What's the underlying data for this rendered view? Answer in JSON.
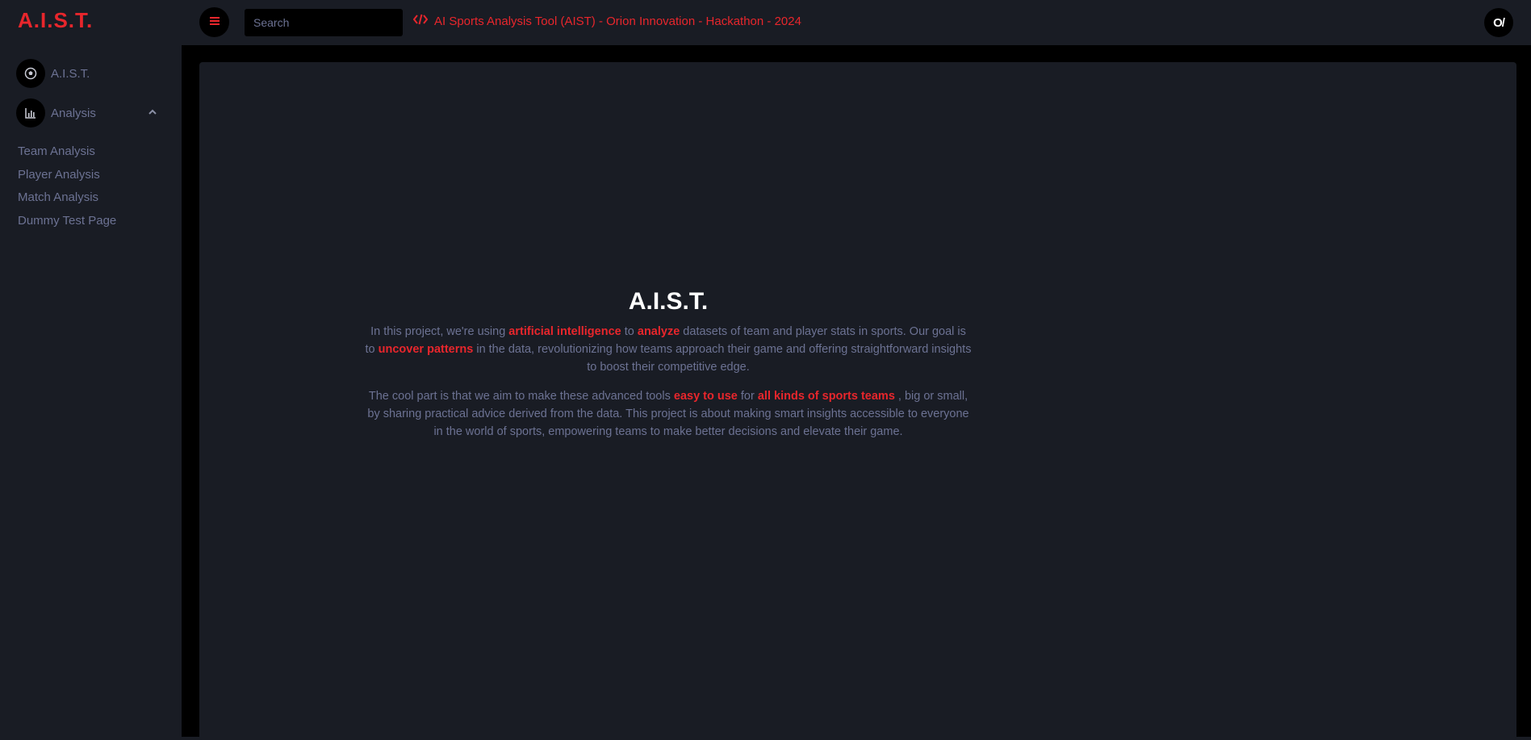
{
  "sidebar": {
    "brand": "A.I.S.T.",
    "items": [
      {
        "label": "A.I.S.T.",
        "icon": "soccer-ball-icon"
      },
      {
        "label": "Analysis",
        "icon": "bar-chart-icon"
      }
    ],
    "submenu": [
      "Team Analysis",
      "Player Analysis",
      "Match Analysis",
      "Dummy Test Page"
    ]
  },
  "header": {
    "menu_icon": "hamburger-icon",
    "search_placeholder": "Search",
    "title": "AI Sports Analysis Tool (AIST) - Orion Innovation - Hackathon - 2024",
    "title_icon": "code-icon",
    "profile_logo": "O/"
  },
  "main": {
    "heading": "A.I.S.T.",
    "p1": {
      "t1": "In this project, we're using ",
      "h1": "artificial intelligence",
      "t2": " to ",
      "h2": "analyze",
      "t3": " datasets of team and player stats in sports. Our goal is to ",
      "h3": "uncover patterns",
      "t4": " in the data, revolutionizing how teams approach their game and offering straightforward insights to boost their competitive edge."
    },
    "p2": {
      "t1": "The cool part is that we aim to make these advanced tools ",
      "h1": "easy to use",
      "t2": " for ",
      "h2": "all kinds of sports teams",
      "t3": " , big or small, by sharing practical advice derived from the data. This project is about making smart insights accessible to everyone in the world of sports, empowering teams to make better decisions and elevate their game."
    }
  },
  "colors": {
    "accent": "#e8262c",
    "background": "#191c24",
    "muted_text": "#6c7293"
  }
}
